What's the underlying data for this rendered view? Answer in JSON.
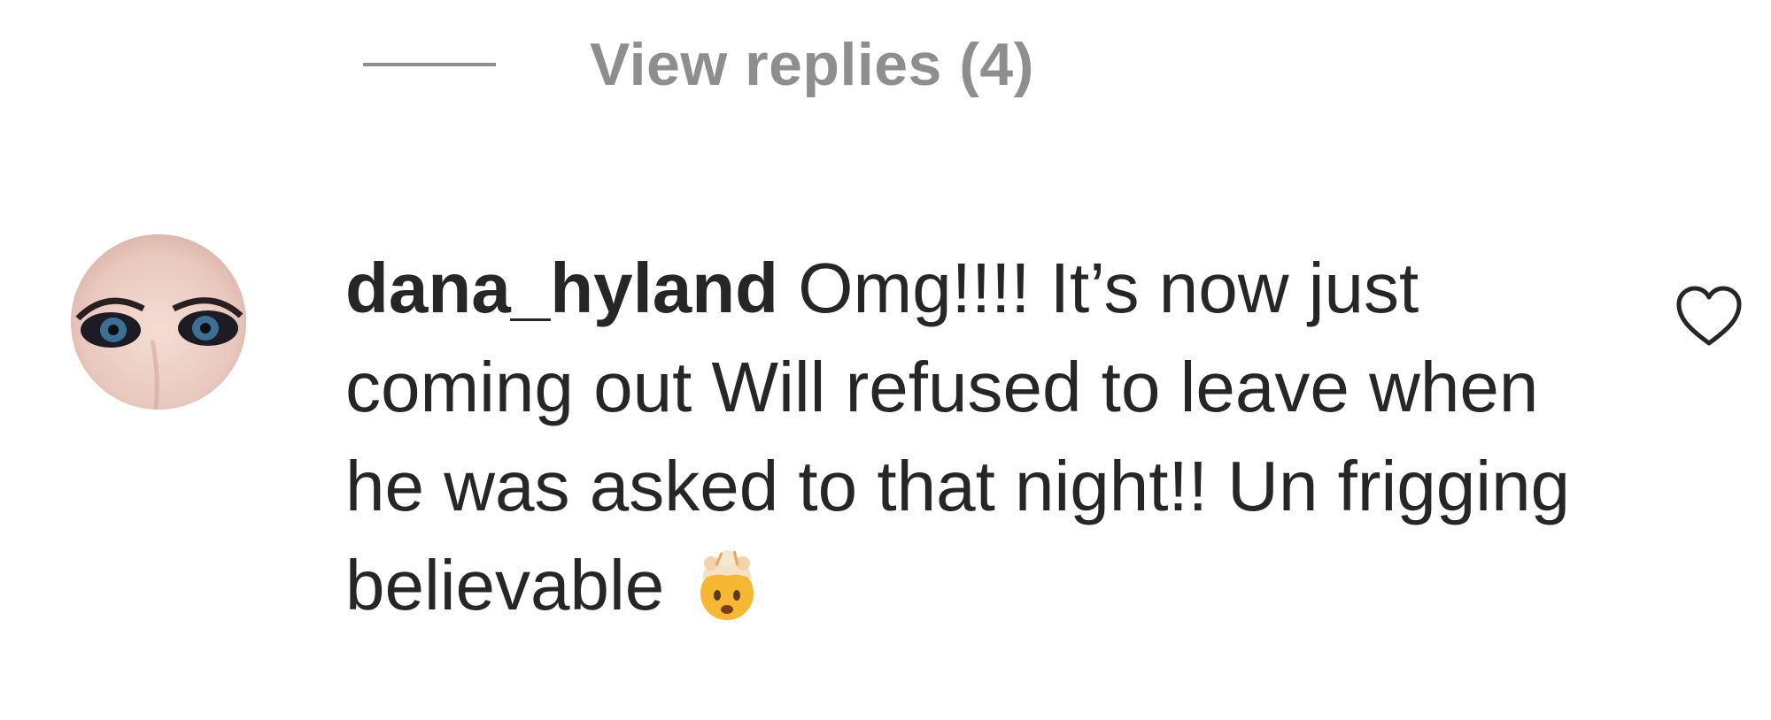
{
  "replies": {
    "label": "View replies (4)"
  },
  "comment": {
    "username": "dana_hyland",
    "text": "Omg!!!! It’s now just coming out Will refused to leave when he was asked to that night!! Un frigging believable",
    "emoji": "exploding-head-emoji"
  },
  "icons": {
    "like": "heart-icon"
  },
  "colors": {
    "text": "#262626",
    "muted": "#8e8e8e",
    "background": "#ffffff"
  }
}
